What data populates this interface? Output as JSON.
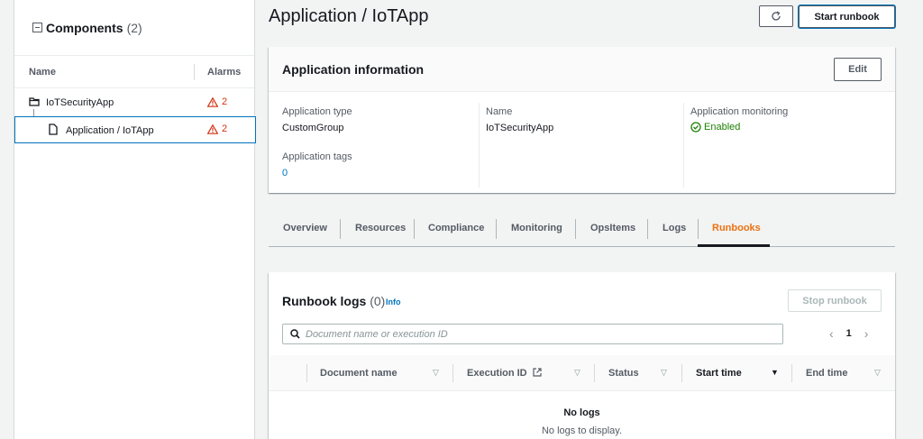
{
  "components": {
    "title": "Components",
    "count": "(2)",
    "col_name": "Name",
    "col_alarms": "Alarms",
    "items": [
      {
        "label": "IoTSecurityApp",
        "alarms": "2"
      },
      {
        "label": "Application / IoTApp",
        "alarms": "2"
      }
    ]
  },
  "header": {
    "title": "Application / IoTApp",
    "start_runbook": "Start runbook"
  },
  "app_info": {
    "title": "Application information",
    "edit": "Edit",
    "type_label": "Application type",
    "type_value": "CustomGroup",
    "tags_label": "Application tags",
    "tags_value": "0",
    "name_label": "Name",
    "name_value": "IoTSecurityApp",
    "monitoring_label": "Application monitoring",
    "monitoring_value": "Enabled"
  },
  "tabs": [
    "Overview",
    "Resources",
    "Compliance",
    "Monitoring",
    "OpsItems",
    "Logs",
    "Runbooks"
  ],
  "runbook": {
    "title": "Runbook logs",
    "count": "(0)",
    "info": "Info",
    "stop": "Stop runbook",
    "search_placeholder": "Document name or execution ID",
    "page": "1",
    "columns": [
      "Document name",
      "Execution ID",
      "Status",
      "Start time",
      "End time"
    ],
    "empty_title": "No logs",
    "empty_sub": "No logs to display."
  },
  "colors": {
    "accent": "#ec7211",
    "link": "#0073bb",
    "alarm": "#d13212",
    "success": "#1d8102"
  }
}
